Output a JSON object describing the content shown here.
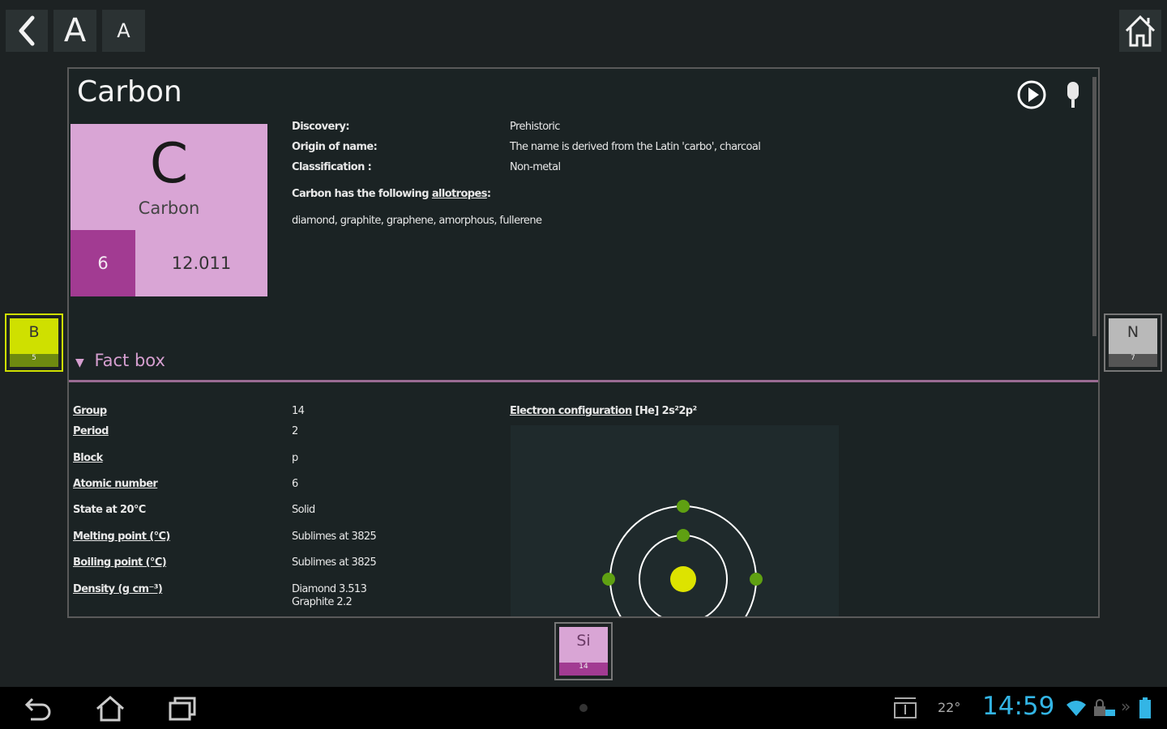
{
  "toolbar": {
    "back": "back-icon",
    "font_large": "A",
    "font_small": "A",
    "home": "home-icon"
  },
  "element": {
    "title": "Carbon",
    "symbol": "C",
    "name": "Carbon",
    "atomic_number": "6",
    "atomic_mass": "12.011",
    "tile_color": "#d9a5d5",
    "number_color": "#a23b92"
  },
  "info": {
    "discovery_label": "Discovery:",
    "discovery_value": "Prehistoric",
    "origin_label": "Origin of name:",
    "origin_value": "The name is derived from the Latin 'carbo', charcoal",
    "classification_label": "Classification :",
    "classification_value": "Non-metal",
    "allotropes_prefix": "Carbon has the following ",
    "allotropes_link": "allotropes",
    "allotropes_suffix": ":",
    "allotropes_list": "diamond, graphite, graphene, amorphous, fullerene"
  },
  "factbox": {
    "toggle": "▼",
    "label": "Fact box"
  },
  "facts": [
    {
      "label": "Group",
      "value": "14"
    },
    {
      "label": "Period",
      "value": "2"
    },
    {
      "label": "Block",
      "value": "p"
    },
    {
      "label": "Atomic number",
      "value": "6"
    },
    {
      "label": "State at 20°C",
      "value": "Solid"
    },
    {
      "label": "Melting point (°C)",
      "value": "Sublimes at 3825"
    },
    {
      "label": "Boiling point (°C)",
      "value": "Sublimes at 3825"
    },
    {
      "label": "Density (g cm⁻³)",
      "value": "Diamond 3.513",
      "value2": "Graphite 2.2"
    }
  ],
  "electron_config": {
    "label": "Electron configuration",
    "value": "[He] 2s²2p²"
  },
  "neighbors": {
    "left": {
      "symbol": "B",
      "number": "5",
      "color": "#cfe000"
    },
    "right": {
      "symbol": "N",
      "number": "7",
      "color": "#b9b9b9"
    },
    "bottom": {
      "symbol": "Si",
      "number": "14",
      "color": "#d9a5d5"
    }
  },
  "statusbar": {
    "temperature": "22°",
    "time": "14:59",
    "time_color": "#33b5e5"
  }
}
